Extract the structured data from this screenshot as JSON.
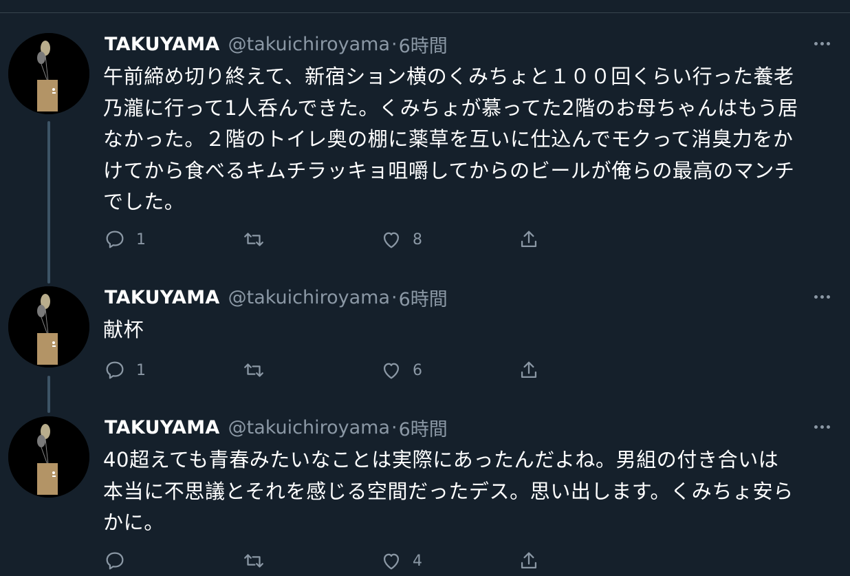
{
  "tweets": [
    {
      "display_name": "TAKUYAMA",
      "handle": "@takuichiroyama",
      "separator": "·",
      "time": "6時間",
      "text": "午前締め切り終えて、新宿ション横のくみちょと１００回くらい行った養老\n乃瀧に行って1人呑んできた。くみちょが慕ってた2階のお母ちゃんはもう居\nなかった。２階のトイレ奥の棚に薬草を互いに仕込んでモクって消臭力をか\nけてから食べるキムチラッキョ咀嚼してからのビールが俺らの最高のマンチ\nでした。",
      "reply_count": "1",
      "retweet_count": "",
      "like_count": "8"
    },
    {
      "display_name": "TAKUYAMA",
      "handle": "@takuichiroyama",
      "separator": "·",
      "time": "6時間",
      "text": "献杯",
      "reply_count": "1",
      "retweet_count": "",
      "like_count": "6"
    },
    {
      "display_name": "TAKUYAMA",
      "handle": "@takuichiroyama",
      "separator": "·",
      "time": "6時間",
      "text": "40超えても青春みたいなことは実際にあったんだよね。男組の付き合いは\n本当に不思議とそれを感じる空間だったデス。思い出します。くみちょ安ら\nかに。",
      "reply_count": "",
      "retweet_count": "",
      "like_count": "4"
    }
  ],
  "icons": {
    "reply": "reply-icon",
    "retweet": "retweet-icon",
    "like": "like-icon",
    "share": "share-icon",
    "more": "more-icon"
  },
  "colors": {
    "background": "#15202b",
    "secondary_text": "#8b98a5",
    "thread_line": "#3d5466"
  }
}
